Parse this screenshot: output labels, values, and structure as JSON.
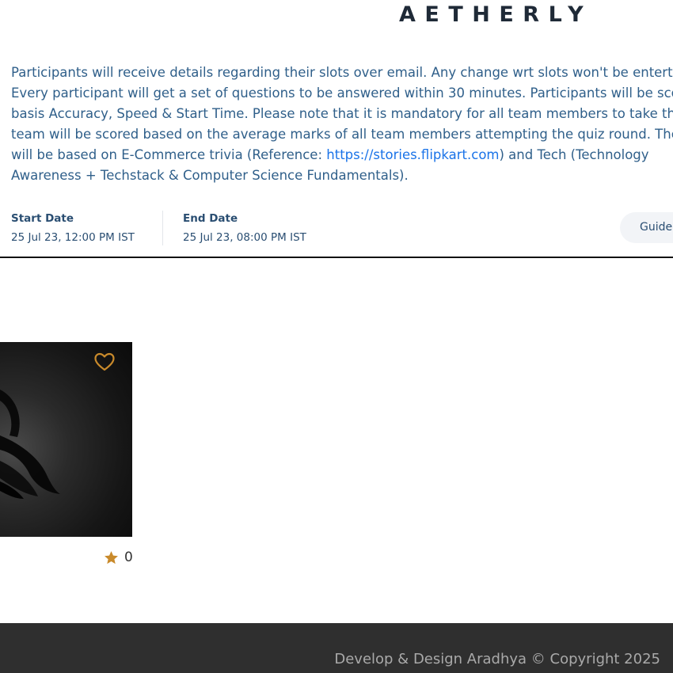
{
  "header": {
    "brand": "AETHERLY"
  },
  "description": {
    "line1": "Participants will receive details regarding their slots over email. Any change wrt slots won't be entertained.",
    "line2": "Every participant will get a set of questions to be answered within 30 minutes. Participants will be scored on the",
    "line3": "basis Accuracy, Speed & Start Time. Please note that it is mandatory for all team members to take the quiz. The",
    "line4": "team will be scored based on the average marks of all team members attempting the quiz round. The questions",
    "line5_prefix": "will be based on E-Commerce trivia (Reference: ",
    "line5_link": "https://stories.flipkart.com",
    "line5_suffix": ") and Tech (Technology",
    "line6": "Awareness + Techstack & Computer Science Fundamentals)."
  },
  "dates": {
    "start_label": "Start Date",
    "start_value": "25 Jul 23, 12:00 PM IST",
    "end_label": "End Date",
    "end_value": "25 Jul 23, 08:00 PM IST"
  },
  "actions": {
    "guidelines_label": "Guidelines"
  },
  "card": {
    "heart_icon": "heart-outline-icon",
    "star_icon": "star-icon",
    "rating_count": "0"
  },
  "footer": {
    "text": "Develop & Design Aradhya © Copyright 2025"
  },
  "colors": {
    "accent": "#c98a2b",
    "link": "#1a73e8",
    "text": "#2f5f8a",
    "footer_bg": "#2f2f2f"
  }
}
